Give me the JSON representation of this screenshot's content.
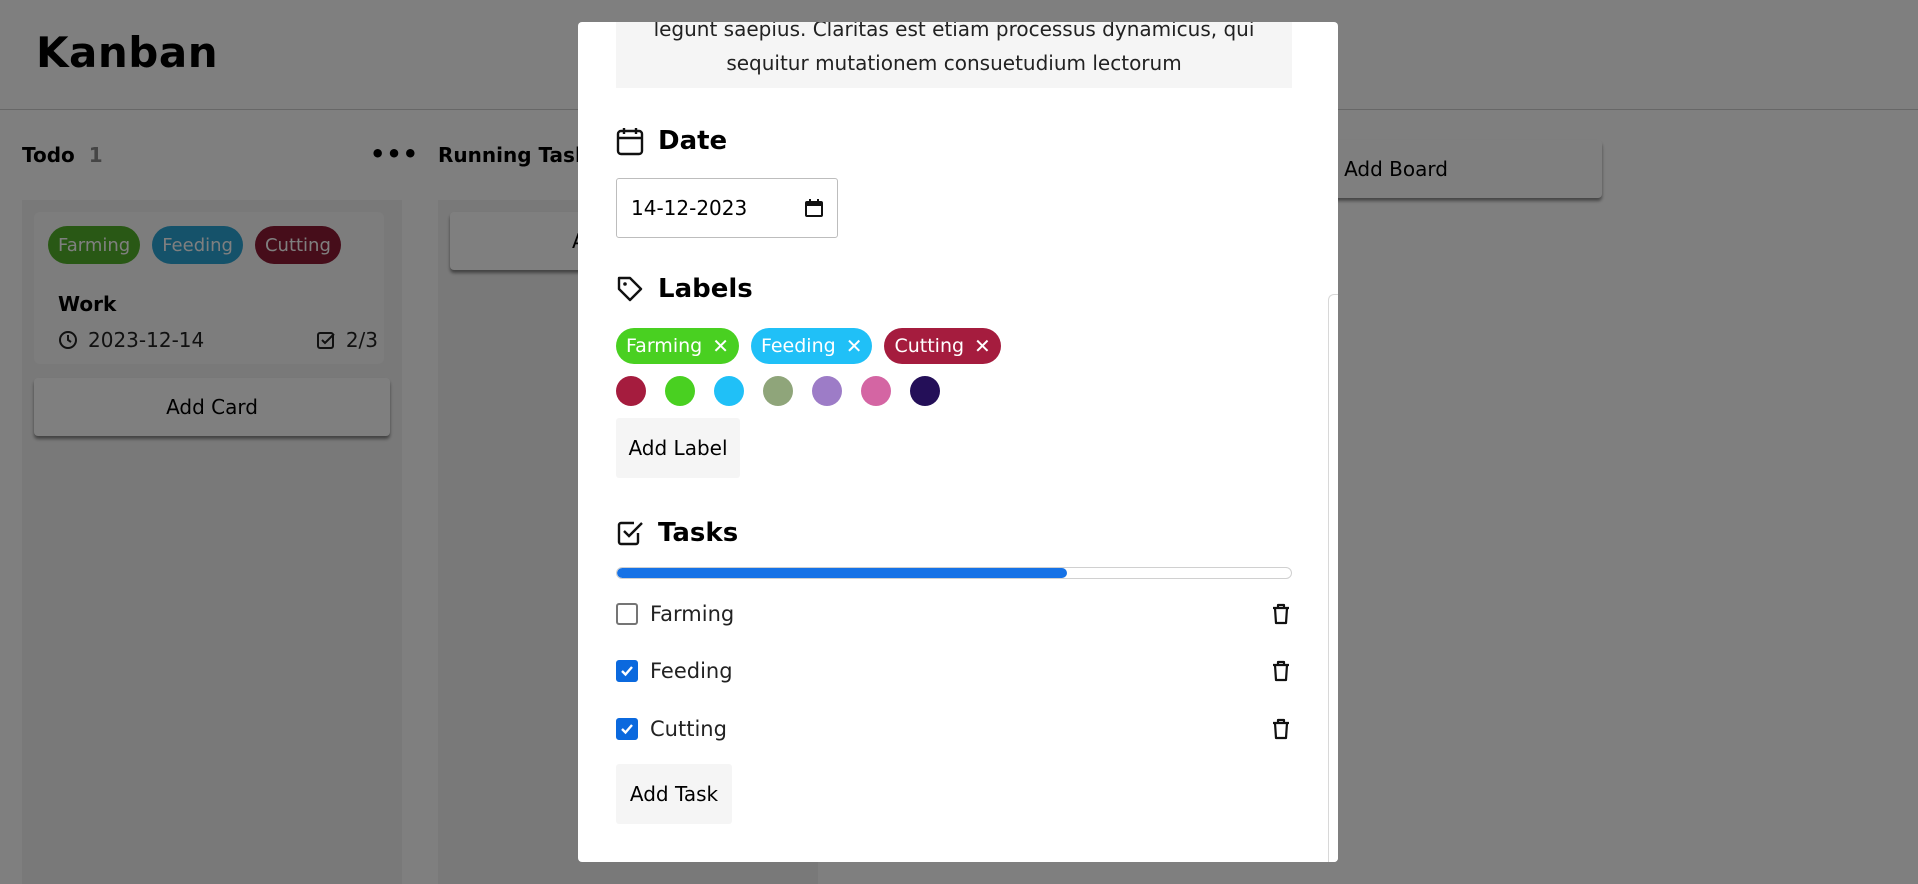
{
  "app": {
    "title": "Kanban"
  },
  "boards": [
    {
      "title": "Todo",
      "count": "1",
      "cards": [
        {
          "labels": [
            {
              "text": "Farming",
              "color": "#52b12a"
            },
            {
              "text": "Feeding",
              "color": "#2ba4d5"
            },
            {
              "text": "Cutting",
              "color": "#8c1a34"
            }
          ],
          "title": "Work",
          "date": "2023-12-14",
          "tasks": "2/3"
        }
      ],
      "add_card_label": "Add Card"
    },
    {
      "title": "Running Task",
      "add_card_label": "A"
    }
  ],
  "add_board_label": "Add Board",
  "modal": {
    "description_lines": [
      "legunt saepius. Claritas est etiam processus dynamicus, qui",
      "sequitur mutationem consuetudium lectorum"
    ],
    "date": {
      "heading": "Date",
      "value": "14-12-2023"
    },
    "labels": {
      "heading": "Labels",
      "items": [
        {
          "text": "Farming",
          "color": "#49d021"
        },
        {
          "text": "Feeding",
          "color": "#20c0f7"
        },
        {
          "text": "Cutting",
          "color": "#a51c3e"
        }
      ],
      "palette": [
        "#a51c3e",
        "#49d021",
        "#20c0f7",
        "#8fa57a",
        "#9d7cc7",
        "#d465a3",
        "#240f58"
      ],
      "add_label": "Add Label"
    },
    "tasks": {
      "heading": "Tasks",
      "progress": 0.667,
      "items": [
        {
          "text": "Farming",
          "checked": false
        },
        {
          "text": "Feeding",
          "checked": true
        },
        {
          "text": "Cutting",
          "checked": true
        }
      ],
      "add_label": "Add Task"
    }
  }
}
